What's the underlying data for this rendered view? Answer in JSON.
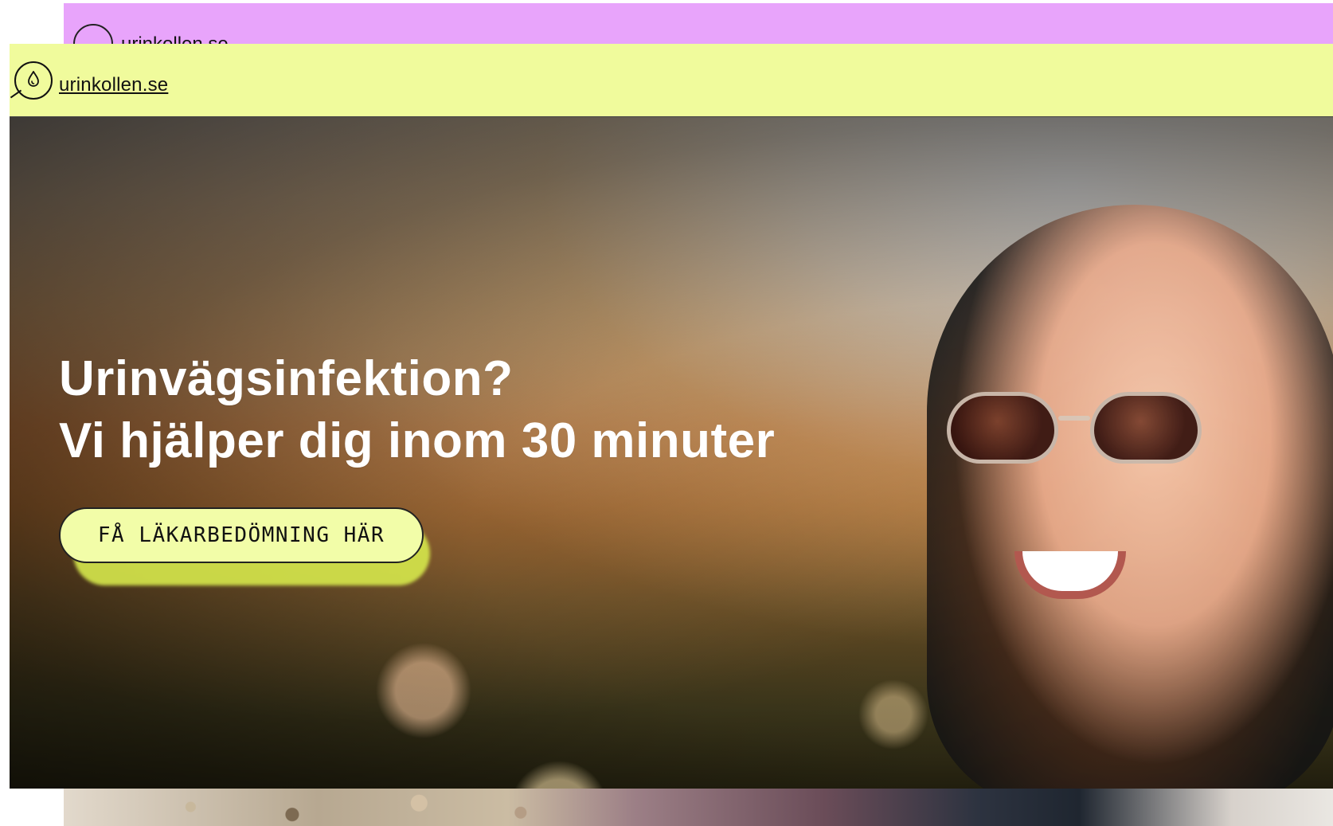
{
  "background_window": {
    "logo_text": "urinkollen.se"
  },
  "foreground": {
    "header": {
      "logo_text": "urinkollen.se"
    },
    "hero": {
      "title_line1": "Urinvägsinfektion?",
      "title_line2": "Vi hjälper dig inom 30 minuter",
      "cta_label": "FÅ LÄKARBEDÖMNING HÄR"
    }
  },
  "colors": {
    "bg_header": "#e8a4fb",
    "fg_header": "#f0fb9c",
    "cta_bg": "#f2fda8",
    "cta_glow": "#d6e84c"
  },
  "icons": {
    "bg_logo": "logo-icon",
    "fg_logo": "droplet-magnifier-icon"
  }
}
